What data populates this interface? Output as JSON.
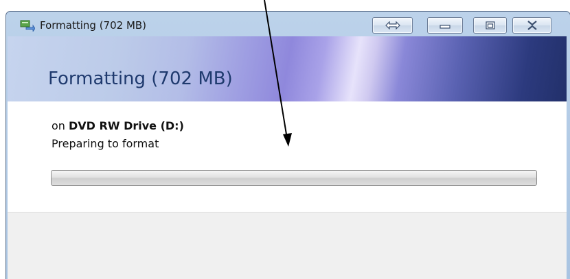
{
  "window": {
    "title": "Formatting (702 MB)",
    "icons": {
      "app": "drive-format-icon",
      "resize": "resize-arrows-icon",
      "minimize": "minimize-icon",
      "maximize": "maximize-icon",
      "close": "close-icon"
    }
  },
  "dialog": {
    "heading": "Formatting (702 MB)",
    "device_prefix": "on ",
    "device_name": "DVD RW Drive (D:)",
    "status": "Preparing to format",
    "progress_percent": 0
  },
  "colors": {
    "heading": "#1f3a6e",
    "arrow": "#000000"
  }
}
